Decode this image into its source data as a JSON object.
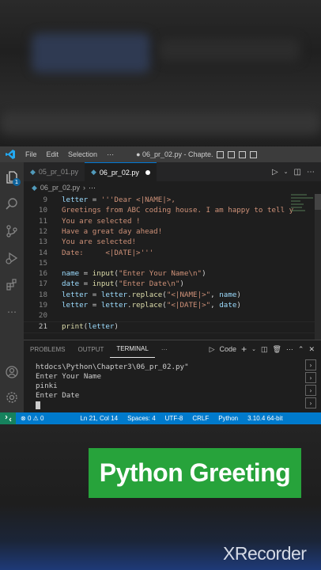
{
  "app": {
    "window_title": "● 06_pr_02.py - Chapte...",
    "menu": [
      "File",
      "Edit",
      "Selection",
      "⋯"
    ]
  },
  "activity": {
    "source_control_badge": "1"
  },
  "tabs": [
    {
      "label": "05_pr_01.py",
      "active": false
    },
    {
      "label": "06_pr_02.py",
      "active": true,
      "modified": true
    }
  ],
  "breadcrumb": "06_pr_02.py",
  "editor": {
    "lines": [
      {
        "num": "9",
        "text": "letter = '''Dear <|NAME|>,"
      },
      {
        "num": "10",
        "text": "Greetings from ABC coding house. I am happy to tell y"
      },
      {
        "num": "11",
        "text": "You are selected !"
      },
      {
        "num": "12",
        "text": "Have a great day ahead!"
      },
      {
        "num": "13",
        "text": "You are selected!"
      },
      {
        "num": "14",
        "text": "Date:     <|DATE|>'''"
      },
      {
        "num": "15",
        "text": ""
      },
      {
        "num": "16",
        "text": "name = input(\"Enter Your Name\\n\")"
      },
      {
        "num": "17",
        "text": "date = input(\"Enter Date\\n\")"
      },
      {
        "num": "18",
        "text": "letter = letter.replace(\"<|NAME|>\", name)"
      },
      {
        "num": "19",
        "text": "letter = letter.replace(\"<|DATE|>\", date)"
      },
      {
        "num": "20",
        "text": ""
      },
      {
        "num": "21",
        "text": "print(letter)"
      }
    ],
    "current_line": "21"
  },
  "panel": {
    "tabs": [
      "PROBLEMS",
      "OUTPUT",
      "TERMINAL",
      "⋯"
    ],
    "active_tab": "TERMINAL",
    "shell": "Code",
    "terminal_lines": [
      "htdocs\\Python\\Chapter3\\06_pr_02.py\"",
      "Enter Your Name",
      "pinki",
      "Enter Date"
    ]
  },
  "status": {
    "errors": "0",
    "warnings": "0",
    "position": "Ln 21, Col 14",
    "spaces": "Spaces: 4",
    "encoding": "UTF-8",
    "eol": "CRLF",
    "language": "Python",
    "interpreter": "3.10.4 64-bit"
  },
  "overlay": {
    "title": "Python Greeting"
  },
  "watermark": "XRecorder",
  "colors": {
    "accent": "#007acc",
    "title_bg": "#27a33b"
  }
}
